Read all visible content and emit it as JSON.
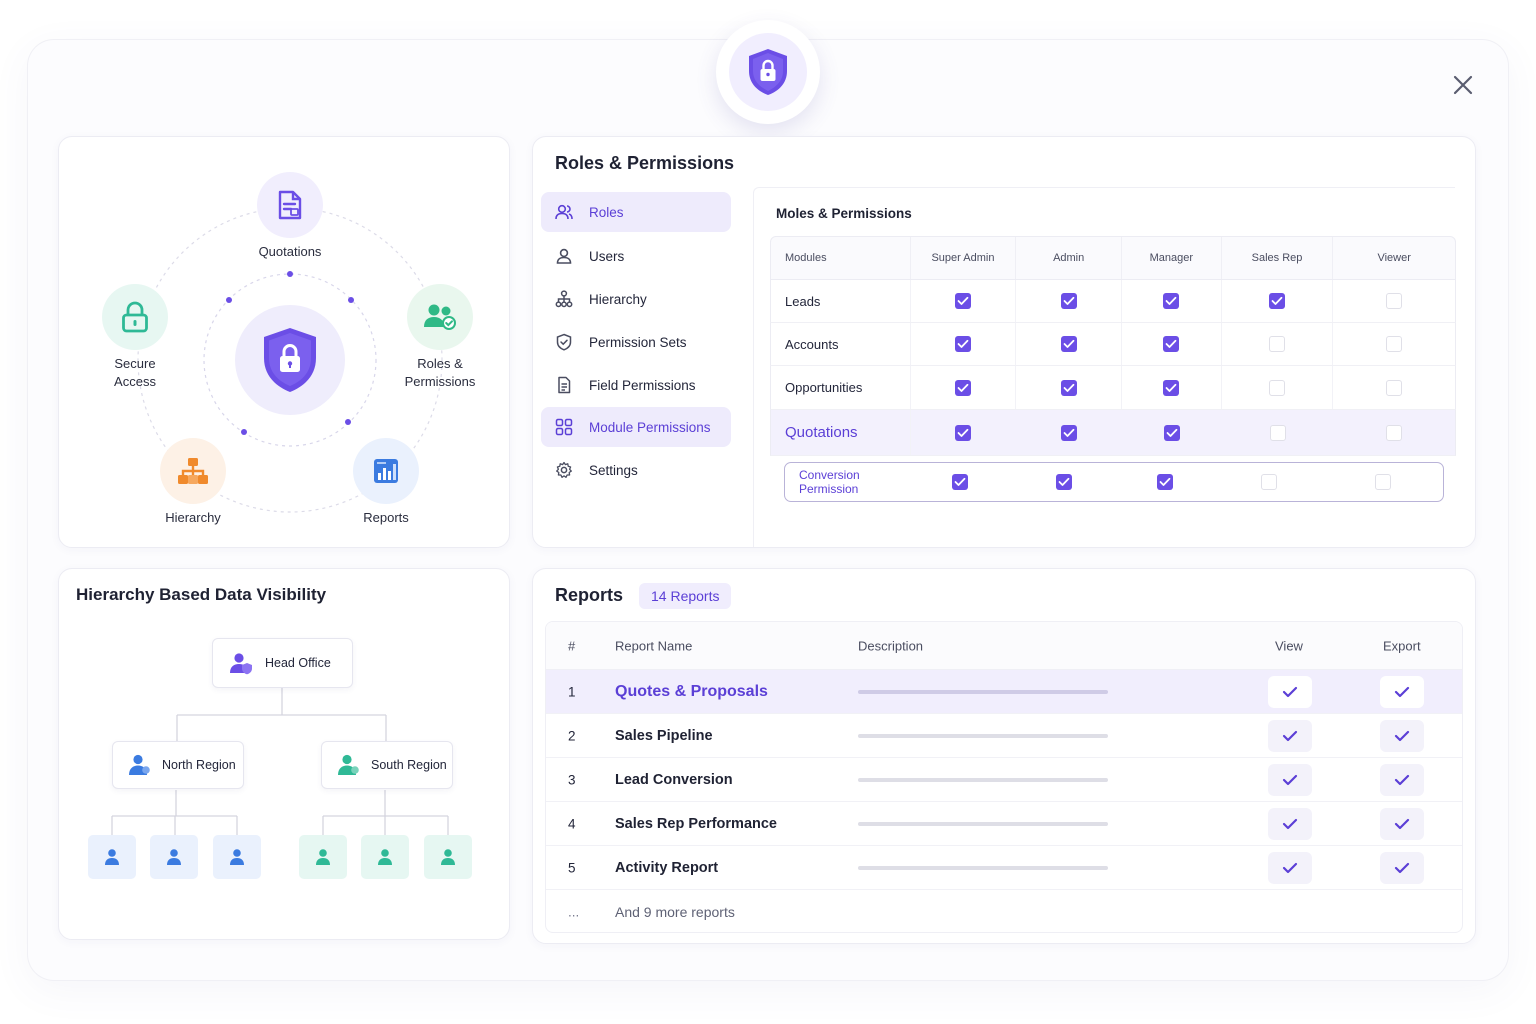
{
  "close_icon": "close-icon",
  "colors": {
    "accent": "#6b4ee6",
    "accent_text": "#5b3fd6",
    "teal": "#2fb996",
    "orange": "#f08a2c",
    "blue": "#3b7be0"
  },
  "features": {
    "nodes": {
      "quotations": "Quotations",
      "secure_access": "Secure\nAccess",
      "roles_permissions": "Roles &\nPermissions",
      "hierarchy": "Hierarchy",
      "reports": "Reports"
    }
  },
  "roles": {
    "title": "Roles & Permissions",
    "sidebar": [
      {
        "label": "Roles",
        "icon": "users-icon",
        "active": true
      },
      {
        "label": "Users",
        "icon": "user-icon",
        "active": false
      },
      {
        "label": "Hierarchy",
        "icon": "hierarchy-icon",
        "active": false
      },
      {
        "label": "Permission Sets",
        "icon": "shield-check-icon",
        "active": false
      },
      {
        "label": "Field Permissions",
        "icon": "document-icon",
        "active": false
      },
      {
        "label": "Module Permissions",
        "icon": "modules-icon",
        "active": true
      },
      {
        "label": "Settings",
        "icon": "gear-icon",
        "active": false
      }
    ],
    "panel_title": "Moles & Permissions",
    "columns": [
      "Modules",
      "Super Admin",
      "Admin",
      "Manager",
      "Sales Rep",
      "Viewer"
    ],
    "rows": [
      {
        "module": "Leads",
        "values": [
          true,
          true,
          true,
          true,
          false
        ]
      },
      {
        "module": "Accounts",
        "values": [
          true,
          true,
          true,
          false,
          false
        ]
      },
      {
        "module": "Opportunities",
        "values": [
          true,
          true,
          true,
          false,
          false
        ]
      },
      {
        "module": "Quotations",
        "values": [
          true,
          true,
          true,
          false,
          false
        ]
      },
      {
        "module": "Conversion Permission",
        "values": [
          true,
          true,
          true,
          false,
          false
        ]
      }
    ]
  },
  "hierarchy": {
    "title": "Hierarchy Based Data Visibility",
    "head": "Head Office",
    "north": "North Region",
    "south": "South Region"
  },
  "reports": {
    "title": "Reports",
    "badge": "14 Reports",
    "columns": {
      "num": "#",
      "name": "Report Name",
      "description": "Description",
      "view": "View",
      "export": "Export"
    },
    "rows": [
      {
        "num": "1",
        "name": "Quotes & Proposals",
        "view": true,
        "export": true
      },
      {
        "num": "2",
        "name": "Sales Pipeline",
        "view": true,
        "export": true
      },
      {
        "num": "3",
        "name": "Lead Conversion",
        "view": true,
        "export": true
      },
      {
        "num": "4",
        "name": "Sales Rep Performance",
        "view": true,
        "export": true
      },
      {
        "num": "5",
        "name": "Activity Report",
        "view": true,
        "export": true
      }
    ],
    "more_num": "...",
    "more_label": "And 9 more reports"
  }
}
